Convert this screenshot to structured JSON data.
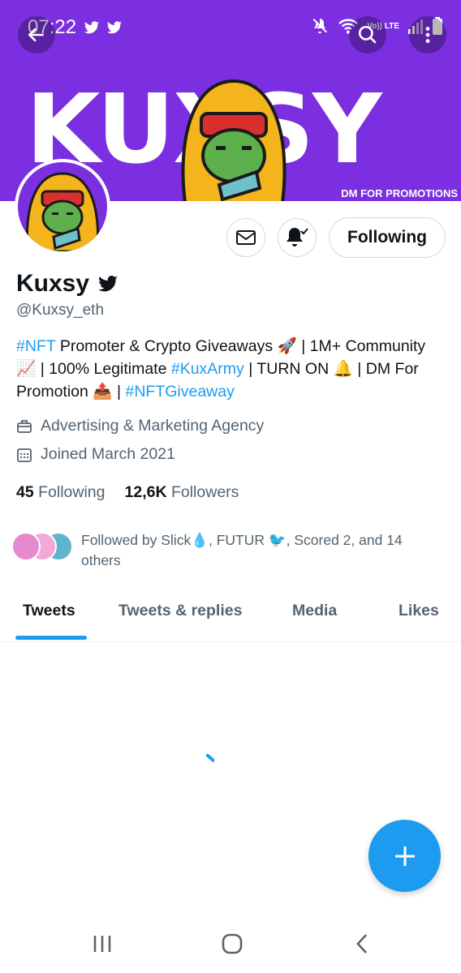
{
  "status_bar": {
    "time": "07:22",
    "network": "Vo)) LTE"
  },
  "banner": {
    "title": "KUXSY",
    "tagline": "DM FOR PROMOTIONS",
    "background": "#7b2fe0"
  },
  "header_icons": {
    "back": "arrow-left-icon",
    "search": "search-icon",
    "more": "more-vertical-icon"
  },
  "profile": {
    "name": "Kuxsy",
    "handle": "@Kuxsy_eth",
    "bio": {
      "hashtag_nft": "#NFT",
      "text1": " Promoter & Crypto Giveaways 🚀 | 1M+ Community 📈 | 100% Legitimate ",
      "hashtag_kuxarmy": "#KuxArmy",
      "text2": " | TURN ON 🔔 | DM For Promotion 📤 | ",
      "hashtag_giveaway": "#NFTGiveaway"
    },
    "category": "Advertising & Marketing Agency",
    "joined": "Joined March 2021",
    "following_count": "45",
    "following_label": "Following",
    "followers_count": "12,6K",
    "followers_label": "Followers",
    "followed_by": "Followed by Slick💧, FUTUR 🐦, Scored 2, and 14 others"
  },
  "actions": {
    "message": "mail-icon",
    "notifications": "bell-icon",
    "following_button": "Following"
  },
  "tabs": [
    {
      "label": "Tweets",
      "active": true
    },
    {
      "label": "Tweets & replies",
      "active": false
    },
    {
      "label": "Media",
      "active": false
    },
    {
      "label": "Likes",
      "active": false
    }
  ],
  "colors": {
    "accent": "#1d9bf0",
    "banner": "#7b2fe0",
    "text": "#0f1419",
    "muted": "#536471"
  }
}
